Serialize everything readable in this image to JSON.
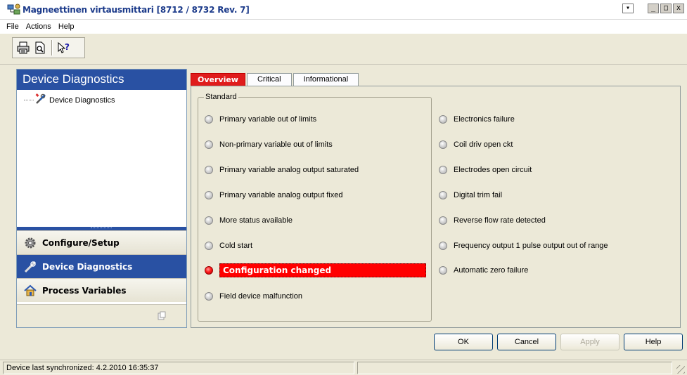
{
  "window": {
    "title": "Magneettinen virtausmittari [8712 / 8732 Rev. 7]",
    "app_icon": "network-device-icon",
    "controls": {
      "sysmenu": "▾",
      "minimize": "_",
      "maximize": "□",
      "close": "x"
    }
  },
  "menu": [
    "File",
    "Actions",
    "Help"
  ],
  "toolbar": {
    "buttons": [
      {
        "name": "print-icon"
      },
      {
        "name": "print-preview-icon"
      },
      {
        "name": "context-help-icon"
      }
    ]
  },
  "left_panel": {
    "header": "Device Diagnostics",
    "tree": [
      {
        "label": "Device Diagnostics",
        "icon": "tools-icon"
      }
    ],
    "nav": [
      {
        "label": "Configure/Setup",
        "icon": "gear-icon",
        "active": false
      },
      {
        "label": "Device Diagnostics",
        "icon": "tools-icon",
        "active": true
      },
      {
        "label": "Process Variables",
        "icon": "home-icon",
        "active": false
      }
    ]
  },
  "tabs": [
    {
      "label": "Overview",
      "active": true
    },
    {
      "label": "Critical",
      "active": false
    },
    {
      "label": "Informational",
      "active": false
    }
  ],
  "standard_group": {
    "legend": "Standard",
    "items": [
      {
        "label": "Primary variable out of limits",
        "active": false
      },
      {
        "label": "Non-primary variable out of limits",
        "active": false
      },
      {
        "label": "Primary variable analog output saturated",
        "active": false
      },
      {
        "label": "Primary variable analog output fixed",
        "active": false
      },
      {
        "label": "More status available",
        "active": false
      },
      {
        "label": "Cold start",
        "active": false
      },
      {
        "label": "Configuration changed",
        "active": true
      },
      {
        "label": "Field device malfunction",
        "active": false
      }
    ]
  },
  "right_group": {
    "items": [
      {
        "label": "Electronics failure",
        "active": false
      },
      {
        "label": "Coil driv open ckt",
        "active": false
      },
      {
        "label": "Electrodes open circuit",
        "active": false
      },
      {
        "label": "Digital trim fail",
        "active": false
      },
      {
        "label": "Reverse flow rate detected",
        "active": false
      },
      {
        "label": "Frequency output 1 pulse output out of range",
        "active": false
      },
      {
        "label": "Automatic zero failure",
        "active": false
      }
    ]
  },
  "buttons": {
    "ok": "OK",
    "cancel": "Cancel",
    "apply": "Apply",
    "help": "Help"
  },
  "status_bar": {
    "text": "Device last synchronized: 4.2.2010 16:35:37"
  },
  "colors": {
    "header_blue": "#2951a3",
    "alert_red": "#ff0000",
    "tab_red": "#e01c1c"
  }
}
